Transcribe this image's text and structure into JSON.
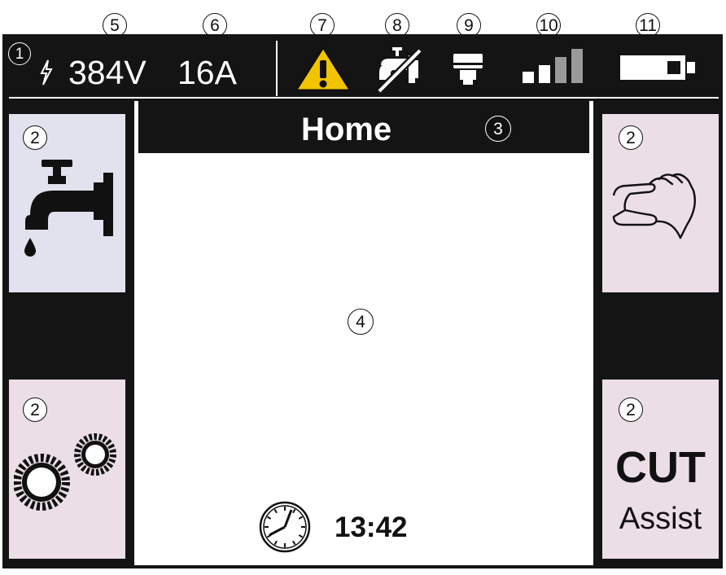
{
  "status_bar": {
    "voltage": "384V",
    "current": "16A",
    "icons": [
      "lightning-icon",
      "warning-icon",
      "water-off-icon",
      "torch-icon",
      "signal-icon",
      "battery-icon"
    ]
  },
  "header": {
    "title": "Home"
  },
  "side_panels": {
    "left_top": {
      "icon": "water-tap-icon"
    },
    "left_bottom": {
      "icon": "gears-icon"
    },
    "right_top": {
      "icon": "hand-icon"
    },
    "right_bottom": {
      "label_main": "CUT",
      "label_sub": "Assist"
    }
  },
  "main": {
    "clock_icon": "clock-icon",
    "time": "13:42"
  },
  "callouts": {
    "c1": "1",
    "c2": "2",
    "c3": "3",
    "c4": "4",
    "c5": "5",
    "c6": "6",
    "c7": "7",
    "c8": "8",
    "c9": "9",
    "c10": "10",
    "c11": "11"
  },
  "colors": {
    "screen_bg": "#141414",
    "panel_blue": "#e2e2ee",
    "panel_pink": "#ecdee6",
    "warning_yellow": "#f2c400",
    "signal_active": "#ffffff",
    "signal_inactive": "#9a9a9a"
  }
}
